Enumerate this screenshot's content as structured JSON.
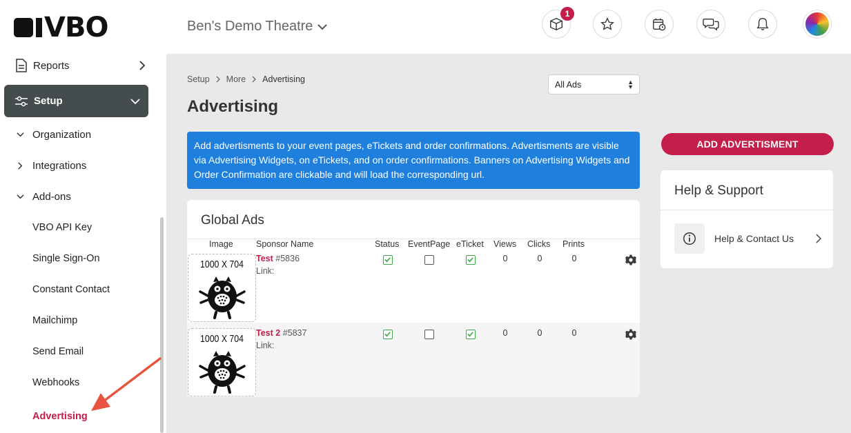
{
  "header": {
    "logo": "VBO",
    "theatre_name": "Ben's Demo Theatre",
    "notification_count": "1",
    "icons": [
      "box-icon",
      "star-icon",
      "calendar-clock-icon",
      "chat-icon",
      "bell-icon",
      "avatar"
    ]
  },
  "sidebar": {
    "reports": "Reports",
    "setup": "Setup",
    "sub": [
      {
        "label": "Organization",
        "state": "expanded"
      },
      {
        "label": "Integrations",
        "state": "collapsed"
      },
      {
        "label": "Add-ons",
        "state": "expanded"
      }
    ],
    "leaves": [
      "VBO API Key",
      "Single Sign-On",
      "Constant Contact",
      "Mailchimp",
      "Send Email",
      "Webhooks",
      "Advertising"
    ],
    "active": "Advertising"
  },
  "breadcrumb": [
    "Setup",
    "More",
    "Advertising"
  ],
  "filter": {
    "selected": "All Ads"
  },
  "page_title": "Advertising",
  "info_text": "Add advertisments to your event pages, eTickets and order confirmations. Advertisments are visible via Advertising Widgets, on eTickets, and on order confirmations. Banners on Advertising Widgets and Order Confirmation are clickable and will load the corresponding url.",
  "global_ads": {
    "title": "Global Ads",
    "columns": [
      "Image",
      "Sponsor Name",
      "Status",
      "EventPage",
      "eTicket",
      "Views",
      "Clicks",
      "Prints"
    ],
    "rows": [
      {
        "image_label": "1000 X 704",
        "name": "Test",
        "id": "#5836",
        "link": "Link:",
        "status": true,
        "eventpage": false,
        "eticket": true,
        "views": "0",
        "clicks": "0",
        "prints": "0"
      },
      {
        "image_label": "1000 X 704",
        "name": "Test 2",
        "id": "#5837",
        "link": "Link:",
        "status": true,
        "eventpage": false,
        "eticket": true,
        "views": "0",
        "clicks": "0",
        "prints": "0"
      }
    ]
  },
  "add_button": "ADD ADVERTISMENT",
  "help": {
    "title": "Help & Support",
    "item": "Help & Contact Us"
  },
  "colors": {
    "accent": "#c41e4a",
    "info": "#1e80dc",
    "setup_bg": "#454c4d",
    "arrow": "#e8543f"
  }
}
